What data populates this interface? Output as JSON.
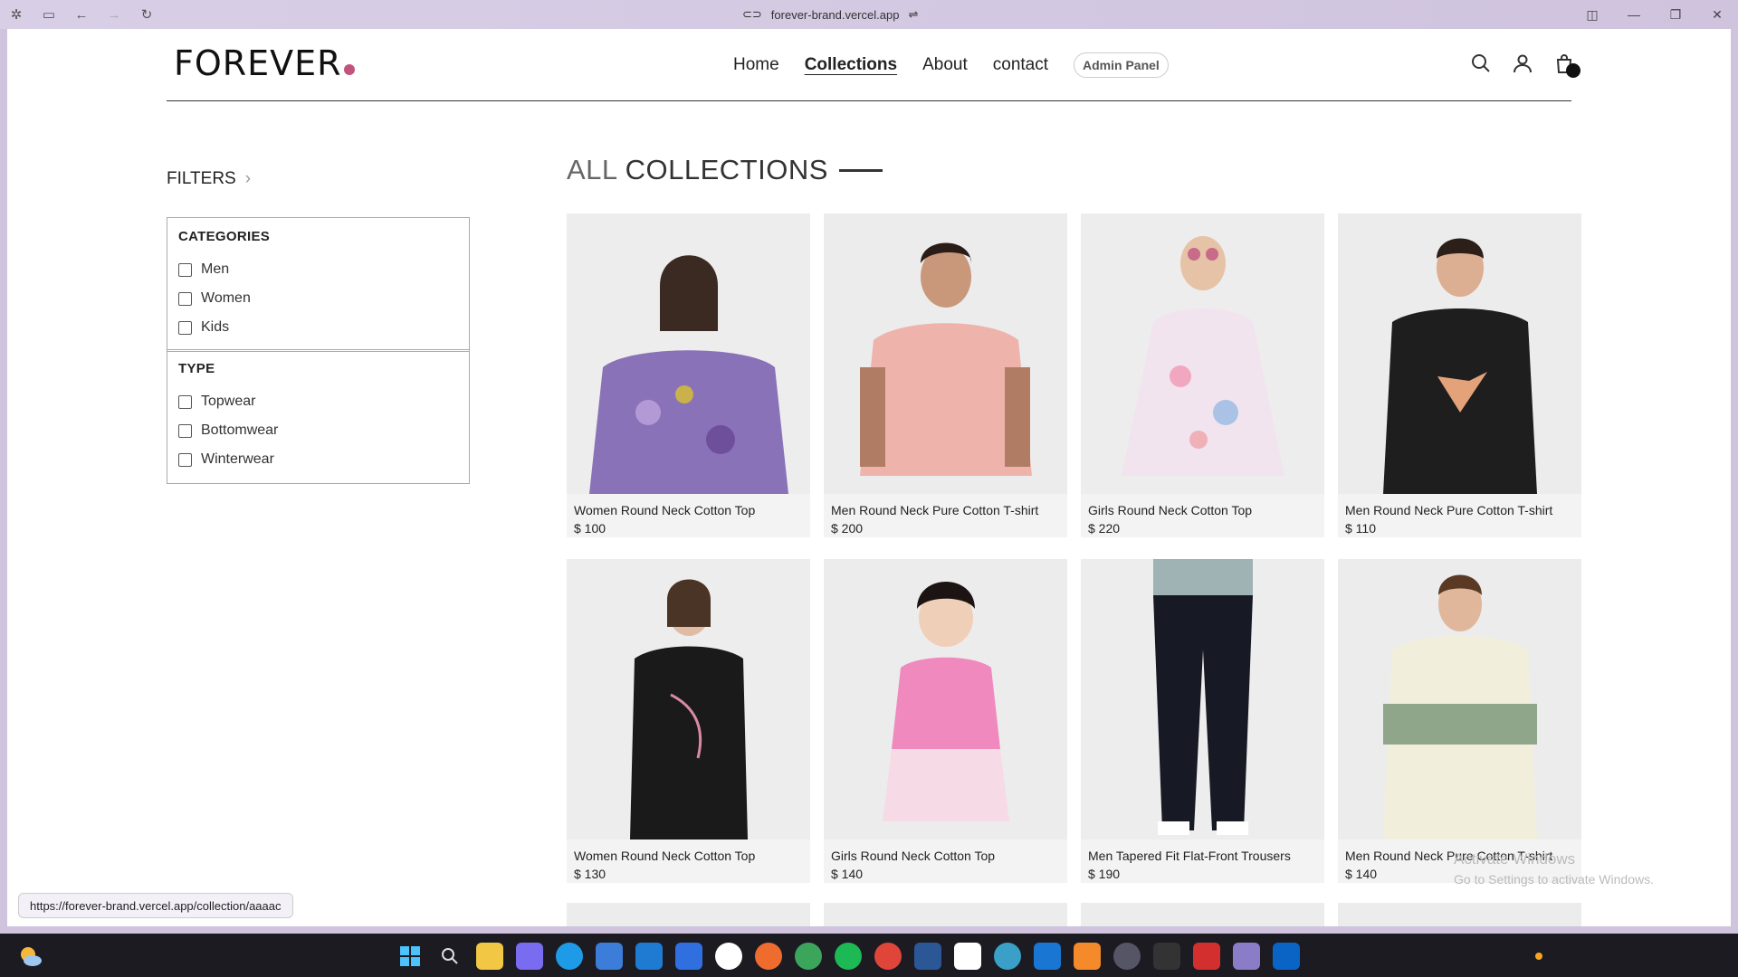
{
  "browser": {
    "url": "forever-brand.vercel.app"
  },
  "header": {
    "logo": "FOREVER",
    "nav": [
      "Home",
      "Collections",
      "About",
      "contact"
    ],
    "admin": "Admin Panel"
  },
  "filters": {
    "title": "FILTERS",
    "categories_title": "CATEGORIES",
    "categories": [
      "Men",
      "Women",
      "Kids"
    ],
    "type_title": "TYPE",
    "types": [
      "Topwear",
      "Bottomwear",
      "Winterwear"
    ]
  },
  "collection": {
    "title_a": "ALL",
    "title_b": "COLLECTIONS",
    "products": [
      {
        "name": "Women Round Neck Cotton Top",
        "price": "$ 100"
      },
      {
        "name": "Men Round Neck Pure Cotton T-shirt",
        "price": "$ 200"
      },
      {
        "name": "Girls Round Neck Cotton Top",
        "price": "$ 220"
      },
      {
        "name": "Men Round Neck Pure Cotton T-shirt",
        "price": "$ 110"
      },
      {
        "name": "Women Round Neck Cotton Top",
        "price": "$ 130"
      },
      {
        "name": "Girls Round Neck Cotton Top",
        "price": "$ 140"
      },
      {
        "name": "Men Tapered Fit Flat-Front Trousers",
        "price": "$ 190"
      },
      {
        "name": "Men Round Neck Pure Cotton T-shirt",
        "price": "$ 140"
      }
    ]
  },
  "status_url": "https://forever-brand.vercel.app/collection/aaaac",
  "watermark": {
    "line1": "Activate Windows",
    "line2": "Go to Settings to activate Windows."
  },
  "colors": {
    "accent": "#c2537f",
    "text": "#222222"
  }
}
